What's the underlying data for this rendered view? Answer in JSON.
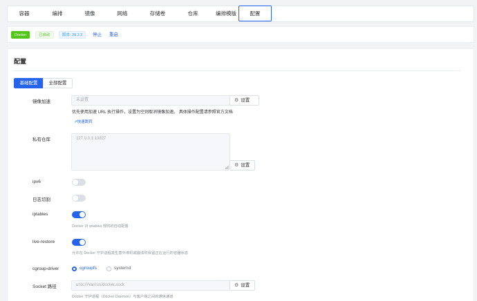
{
  "tabs": [
    {
      "label": "容器"
    },
    {
      "label": "编排"
    },
    {
      "label": "镜像"
    },
    {
      "label": "网络"
    },
    {
      "label": "存储卷"
    },
    {
      "label": "仓库"
    },
    {
      "label": "编排模版"
    },
    {
      "label": "配置",
      "active": true
    }
  ],
  "status": {
    "docker_badge": "Docker",
    "state_badge": "已启动",
    "version_badge": "版本: 28.2.2",
    "stop_label": "停止",
    "restart_label": "重启"
  },
  "card": {
    "title": "配置",
    "mode_basic": "基础配置",
    "mode_all": "全部配置"
  },
  "form": {
    "mirror": {
      "label": "镜像加速",
      "placeholder": "未设置",
      "button": "设置",
      "help": "优先使用加速 URL 执行操作，设置为空则取消镜像加速。 具体操作配置请参照官方文档",
      "link": "↗快速跳转"
    },
    "registry": {
      "label": "私有仓库",
      "placeholder": "127.0.0.1:19827",
      "button": "设置"
    },
    "ipv6": {
      "label": "ipv6",
      "enabled": false
    },
    "log_rotate": {
      "label": "日志切割",
      "enabled": false
    },
    "iptables": {
      "label": "iptables",
      "enabled": true,
      "hint": "Docker 对 iptables 规则的自动配置"
    },
    "live_restore": {
      "label": "live-restore",
      "enabled": true,
      "hint": "允许在 Docker 守护进程发生意外停机或崩溃时保留正在运行的容器状态"
    },
    "cgroup": {
      "label": "cgroup-driver",
      "options": [
        "cgroupfs",
        "systemd"
      ],
      "selected": "cgroupfs"
    },
    "socket": {
      "label": "Socket 路径",
      "placeholder": "unix:///var/run/docker.sock",
      "button": "设置",
      "hint": "Docker 守护进程（Docker Daemon）与客户端之间的通信通道"
    }
  },
  "colors": {
    "primary": "#2563eb",
    "success": "#52c41a",
    "page_bg": "#f2f3f5"
  }
}
